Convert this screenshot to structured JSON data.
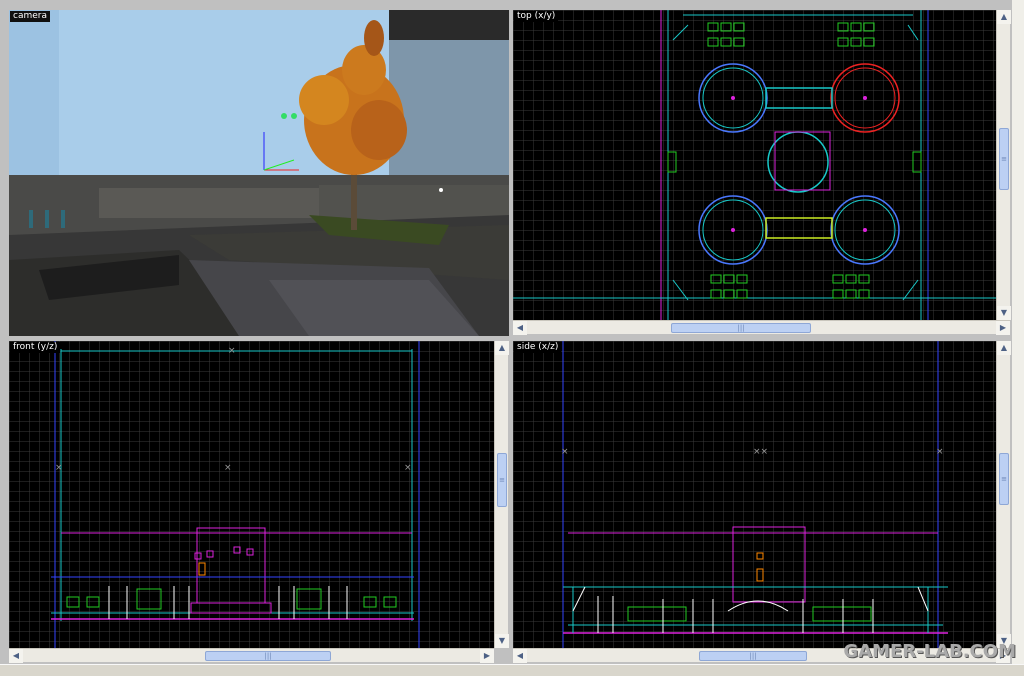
{
  "viewports": {
    "camera": {
      "label": "camera"
    },
    "top": {
      "label": "top (x/y)"
    },
    "front": {
      "label": "front (y/z)"
    },
    "side": {
      "label": "side (x/z)"
    }
  },
  "watermark": "GAMER-LAB.COM",
  "colors": {
    "grid": "#2f2f2f",
    "grid_major": "#3a3a55",
    "cyan": "#18c9c9",
    "blue": "#3344ff",
    "magenta": "#dd22dd",
    "green": "#22cc22",
    "red": "#ee2222",
    "sky": "#a9cdea",
    "tree": "#c8731c"
  }
}
